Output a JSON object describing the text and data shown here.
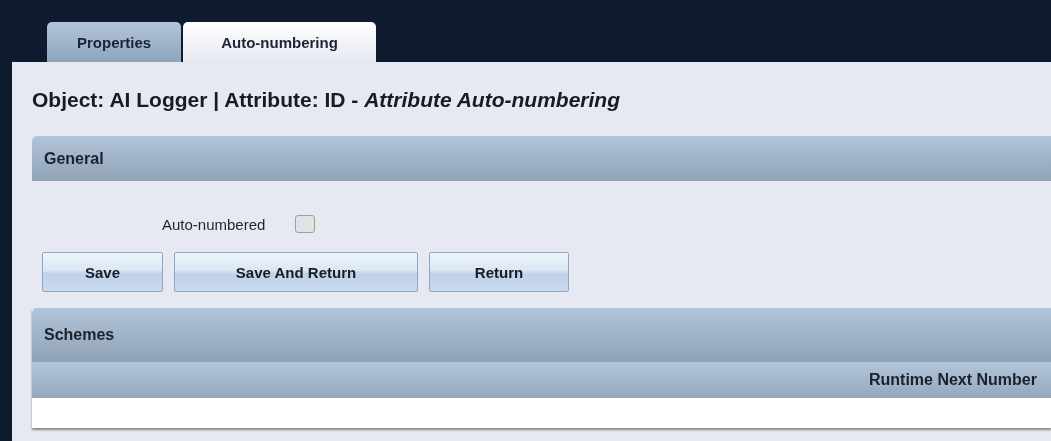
{
  "tabs": [
    {
      "label": "Properties",
      "selected": false
    },
    {
      "label": "Auto-numbering",
      "selected": true
    }
  ],
  "heading": "Object: AI Logger | Attribute: ID - *Attribute Auto-numbering*",
  "general": {
    "title": "General",
    "auto_numbered": {
      "label": "Auto-numbered",
      "checked": false
    }
  },
  "buttons": [
    "Save",
    "Save And Return",
    "Return"
  ],
  "schemes": {
    "title": "Schemes",
    "columns": [
      "Runtime Next Number"
    ]
  }
}
